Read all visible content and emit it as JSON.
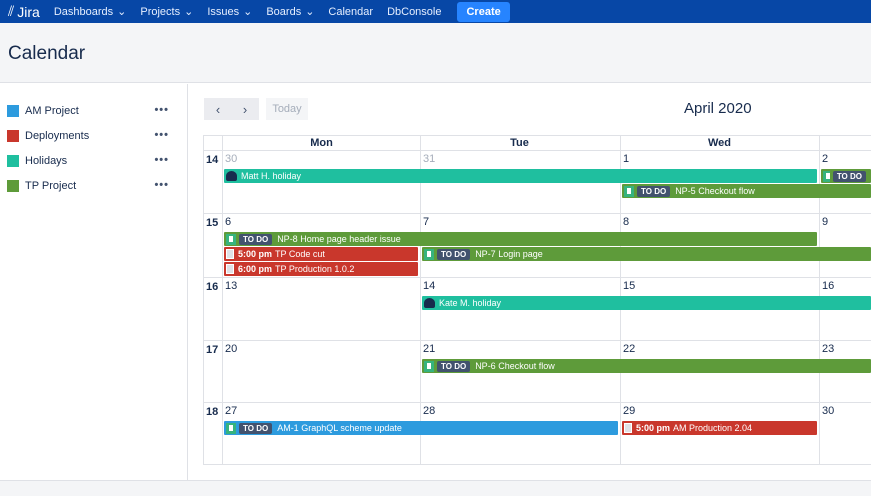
{
  "nav": {
    "logo": "Jira",
    "items": [
      "Dashboards",
      "Projects",
      "Issues",
      "Boards"
    ],
    "calendar": "Calendar",
    "dbconsole": "DbConsole",
    "create": "Create"
  },
  "page_title": "Calendar",
  "calendars": [
    {
      "name": "AM Project",
      "color": "#2d9bde"
    },
    {
      "name": "Deployments",
      "color": "#c9372c"
    },
    {
      "name": "Holidays",
      "color": "#1fbf9f"
    },
    {
      "name": "TP Project",
      "color": "#5e9b3a"
    }
  ],
  "more_label": "•••",
  "toolbar": {
    "prev": "‹",
    "next": "›",
    "today": "Today",
    "month": "April 2020"
  },
  "days": [
    "Mon",
    "Tue",
    "Wed"
  ],
  "weeks": [
    {
      "num": "14",
      "dates": [
        "30",
        "31",
        "1",
        "2"
      ],
      "muted": [
        true,
        true,
        false,
        false
      ]
    },
    {
      "num": "15",
      "dates": [
        "6",
        "7",
        "8",
        "9"
      ],
      "muted": [
        false,
        false,
        false,
        false
      ]
    },
    {
      "num": "16",
      "dates": [
        "13",
        "14",
        "15",
        "16"
      ],
      "muted": [
        false,
        false,
        false,
        false
      ]
    },
    {
      "num": "17",
      "dates": [
        "20",
        "21",
        "22",
        "23"
      ],
      "muted": [
        false,
        false,
        false,
        false
      ]
    },
    {
      "num": "18",
      "dates": [
        "27",
        "28",
        "29",
        "30"
      ],
      "muted": [
        false,
        false,
        false,
        false
      ]
    }
  ],
  "events": [
    {
      "type": "holiday",
      "week": 0,
      "day": 0,
      "span": 3,
      "lane": 0,
      "title": "Matt H. holiday",
      "color": "#1fbf9f"
    },
    {
      "type": "issue",
      "week": 0,
      "day": 3,
      "span": 1,
      "lane": 0,
      "status": "TO DO",
      "title": "",
      "color": "#5e9b3a"
    },
    {
      "type": "issue",
      "week": 0,
      "day": 2,
      "span": 2,
      "lane": 1,
      "status": "TO DO",
      "title": "NP-5 Checkout flow",
      "color": "#5e9b3a"
    },
    {
      "type": "issue",
      "week": 1,
      "day": 0,
      "span": 3,
      "lane": 0,
      "status": "TO DO",
      "title": "NP-8 Home page header issue",
      "color": "#5e9b3a"
    },
    {
      "type": "deploy",
      "week": 1,
      "day": 0,
      "span": 1,
      "lane": 1,
      "time": "5:00 pm",
      "title": "TP Code cut",
      "color": "#c9372c"
    },
    {
      "type": "issue",
      "week": 1,
      "day": 1,
      "span": 3,
      "lane": 1,
      "status": "TO DO",
      "title": "NP-7 Login page",
      "color": "#5e9b3a"
    },
    {
      "type": "deploy",
      "week": 1,
      "day": 0,
      "span": 1,
      "lane": 2,
      "time": "6:00 pm",
      "title": "TP Production 1.0.2",
      "color": "#c9372c"
    },
    {
      "type": "holiday",
      "week": 2,
      "day": 1,
      "span": 3,
      "lane": 0,
      "title": "Kate M. holiday",
      "color": "#1fbf9f"
    },
    {
      "type": "issue",
      "week": 3,
      "day": 1,
      "span": 3,
      "lane": 0,
      "status": "TO DO",
      "title": "NP-6 Checkout flow",
      "color": "#5e9b3a"
    },
    {
      "type": "issue",
      "week": 4,
      "day": 0,
      "span": 2,
      "lane": 0,
      "status": "TO DO",
      "title": "AM-1 GraphQL scheme update",
      "color": "#2d9bde"
    },
    {
      "type": "deploy",
      "week": 4,
      "day": 2,
      "span": 1,
      "lane": 0,
      "time": "5:00 pm",
      "title": "AM Production 2.04",
      "color": "#c9372c"
    }
  ]
}
